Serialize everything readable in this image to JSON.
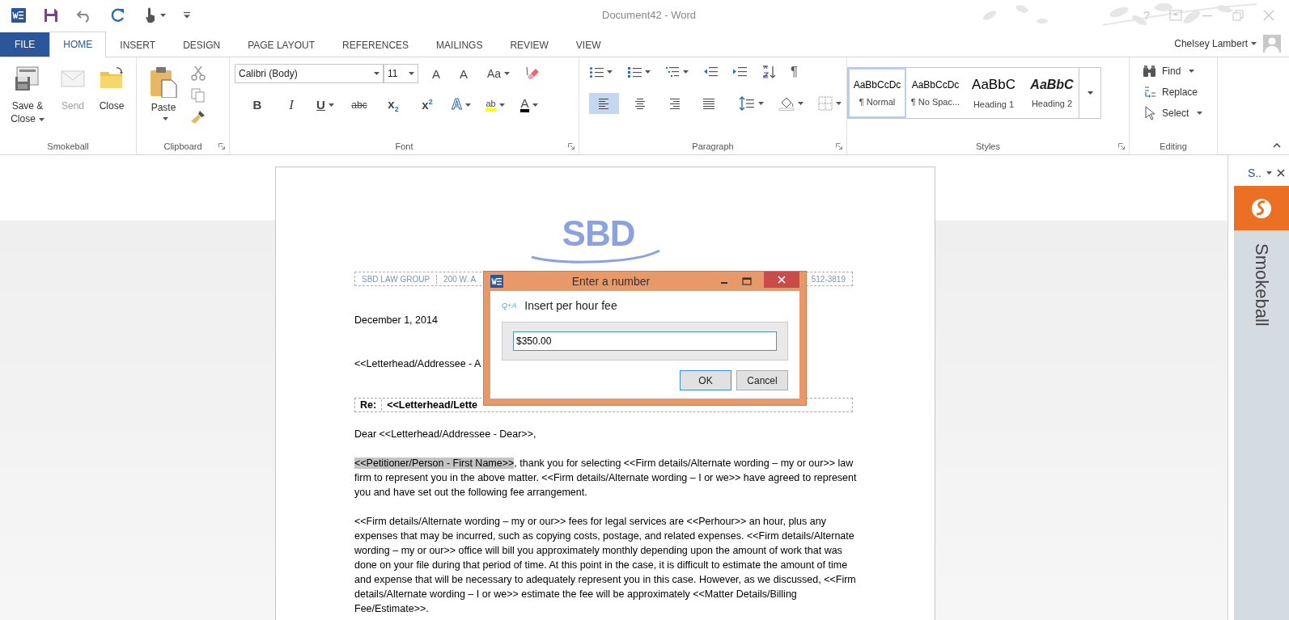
{
  "window": {
    "title": "Document42 - Word",
    "help": "?"
  },
  "tabs": [
    {
      "label": "FILE",
      "kind": "backstage",
      "selected": false
    },
    {
      "label": "HOME",
      "kind": "tab",
      "selected": true
    },
    {
      "label": "INSERT",
      "kind": "tab",
      "selected": false
    },
    {
      "label": "DESIGN",
      "kind": "tab",
      "selected": false
    },
    {
      "label": "PAGE LAYOUT",
      "kind": "tab",
      "selected": false
    },
    {
      "label": "REFERENCES",
      "kind": "tab",
      "selected": false
    },
    {
      "label": "MAILINGS",
      "kind": "tab",
      "selected": false
    },
    {
      "label": "REVIEW",
      "kind": "tab",
      "selected": false
    },
    {
      "label": "VIEW",
      "kind": "tab",
      "selected": false
    }
  ],
  "user": {
    "name": "Chelsey Lambert"
  },
  "ribbon": {
    "groups": [
      {
        "kind": "smokeball",
        "label": "Smokeball",
        "launcher": false,
        "buttons": [
          {
            "kind": "save-close",
            "label": "Save & Close",
            "dropdown": true,
            "disabled": false
          },
          {
            "kind": "send",
            "label": "Send",
            "dropdown": false,
            "disabled": true
          },
          {
            "kind": "close",
            "label": "Close",
            "dropdown": false,
            "disabled": false
          }
        ]
      },
      {
        "kind": "clipboard",
        "label": "Clipboard",
        "launcher": true,
        "paste": "Paste"
      },
      {
        "kind": "font",
        "label": "Font",
        "launcher": true,
        "typeface": "Calibri (Body)",
        "points": "11",
        "grow": "A",
        "shrink": "A",
        "change_case": "Aa",
        "format_buttons": [
          {
            "kind": "bold",
            "glyph": "B",
            "dropdown": false
          },
          {
            "kind": "italic",
            "glyph": "I",
            "dropdown": false
          },
          {
            "kind": "underline",
            "glyph": "U",
            "dropdown": true
          },
          {
            "kind": "strikethrough",
            "glyph": "abc",
            "dropdown": false
          },
          {
            "kind": "subscript",
            "glyph": "x$_{2}$",
            "dropdown": false
          },
          {
            "kind": "superscript",
            "glyph": "x$^{2}$",
            "dropdown": false
          },
          {
            "kind": "text-effects",
            "glyph": "A",
            "dropdown": true
          },
          {
            "kind": "highlight",
            "glyph": "ab",
            "dropdown": true
          },
          {
            "kind": "font-color",
            "glyph": "A",
            "dropdown": true
          }
        ]
      },
      {
        "kind": "paragraph",
        "label": "Paragraph",
        "launcher": true,
        "pilcrow": "¶",
        "alignments": [
          {
            "kind": "left",
            "selected": true
          },
          {
            "kind": "center",
            "selected": false
          },
          {
            "kind": "right",
            "selected": false
          },
          {
            "kind": "justify",
            "selected": false
          }
        ]
      },
      {
        "kind": "styles",
        "label": "Styles",
        "launcher": true,
        "styles": [
          {
            "kind": "normal",
            "preview": "AaBbCcDc",
            "name": "¶ Normal",
            "selected": true
          },
          {
            "kind": "normal",
            "preview": "AaBbCcDc",
            "name": "¶ No Spac...",
            "selected": false
          },
          {
            "kind": "heading1",
            "preview": "AaBbC",
            "name": "Heading 1",
            "selected": false
          },
          {
            "kind": "heading2",
            "preview": "AaBbC",
            "name": "Heading 2",
            "selected": false
          }
        ]
      },
      {
        "kind": "editing",
        "label": "Editing",
        "launcher": false,
        "buttons": [
          {
            "kind": "find",
            "label": "Find",
            "dropdown": true
          },
          {
            "kind": "replace",
            "label": "Replace",
            "dropdown": false
          },
          {
            "kind": "select",
            "label": "Select",
            "dropdown": true
          }
        ]
      }
    ]
  },
  "document": {
    "logo": "SBD",
    "letterhead": [
      "SBD LAW GROUP",
      "200 W. A",
      "512-3819"
    ],
    "date": "December 1, 2014",
    "addressee": "<<Letterhead/Addressee - A",
    "re": {
      "label": "Re:",
      "value": "<<Letterhead/Lette"
    },
    "salutation": "Dear <<Letterhead/Addressee - Dear>>,",
    "paragraphs": [
      [
        {
          "text": "<<Petitioner/Person - First Name>>",
          "highlighted": true
        },
        {
          "text": ", thank you for selecting <<Firm details/Alternate wording – my or our>> law firm to represent you in the above matter.  <<Firm details/Alternate wording – I or we>> have agreed to represent you and have set out the following fee arrangement.",
          "highlighted": false
        }
      ],
      [
        {
          "text": "<<Firm details/Alternate wording – my or our>> fees for legal services are <<Perhour>> an hour, plus any expenses that may be incurred, such as copying costs, postage, and related expenses.  <<Firm details/Alternate wording – my or our>> office will bill you approximately monthly depending upon the amount of work that was done on your file during that period of time.  At this point in the case, it is difficult to estimate the amount of time and expense that will be necessary to adequately represent you in this case.  However, as we discussed, <<Firm details/Alternate wording – I or we>> estimate the fee will be approximately <<Matter Details/Billing Fee/Estimate>>.",
          "highlighted": false
        }
      ]
    ]
  },
  "dialog": {
    "title": "Enter a number",
    "tag": "Q+A",
    "prompt": "Insert per hour fee",
    "value": "$350.00",
    "buttons": [
      {
        "label": "OK",
        "default": true
      },
      {
        "label": "Cancel",
        "default": false
      }
    ]
  },
  "task_pane": {
    "title": "S..",
    "label": "Smokeball"
  }
}
